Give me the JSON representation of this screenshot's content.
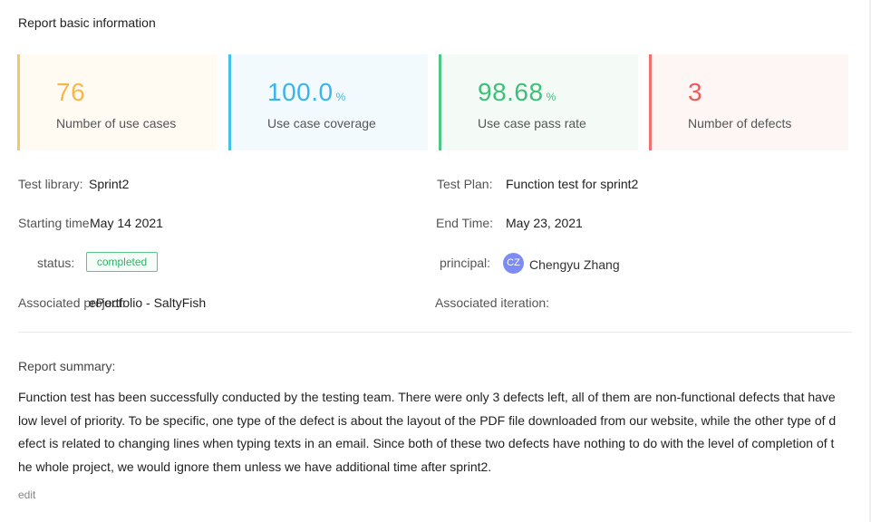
{
  "section_title": "Report basic information",
  "stats": [
    {
      "value": "76",
      "unit": "",
      "label": "Number of use cases",
      "color": "#f7b84b",
      "bg": "#fffaf2",
      "border": "#f6c66e"
    },
    {
      "value": "100.0",
      "unit": "%",
      "label": "Use case coverage",
      "color": "#3bb4ec",
      "bg": "#f3fafe",
      "border": "#48c0ee"
    },
    {
      "value": "98.68",
      "unit": "%",
      "label": "Use case pass rate",
      "color": "#3cc07a",
      "bg": "#f4fbf7",
      "border": "#4fc887"
    },
    {
      "value": "3",
      "unit": "",
      "label": "Number of defects",
      "color": "#f05a5a",
      "bg": "#fef5f5",
      "border": "#f07070"
    }
  ],
  "info": {
    "test_library": {
      "label": "Test library:",
      "value": "Sprint2"
    },
    "test_plan": {
      "label": "Test Plan:",
      "value": "Function test for sprint2"
    },
    "starting_time": {
      "label": "Starting time",
      "value": "May 14 2021"
    },
    "end_time": {
      "label": "End Time:",
      "value": "May 23, 2021"
    },
    "status": {
      "label": "status:",
      "value": "completed"
    },
    "principal": {
      "label": "principal:",
      "initials": "CZ",
      "name": "Chengyu Zhang"
    },
    "associated_project": {
      "label": "Associated project:",
      "value": "ePortfolio - SaltyFish"
    },
    "associated_iteration": {
      "label": "Associated iteration:",
      "value": "--"
    }
  },
  "summary": {
    "label": "Report summary:",
    "text": "Function test has been successfully conducted by the testing team. There were only 3 defects left, all of them are non-functional defects that have low level of priority. To be specific, one type of the defect is about the layout of the PDF file downloaded from our website, while the other type of defect is related to changing lines when typing texts in an email. Since both of these two defects have nothing to do with the level of completion of the whole project, we would ignore them unless we have additional time after sprint2.",
    "edit_label": "edit"
  }
}
